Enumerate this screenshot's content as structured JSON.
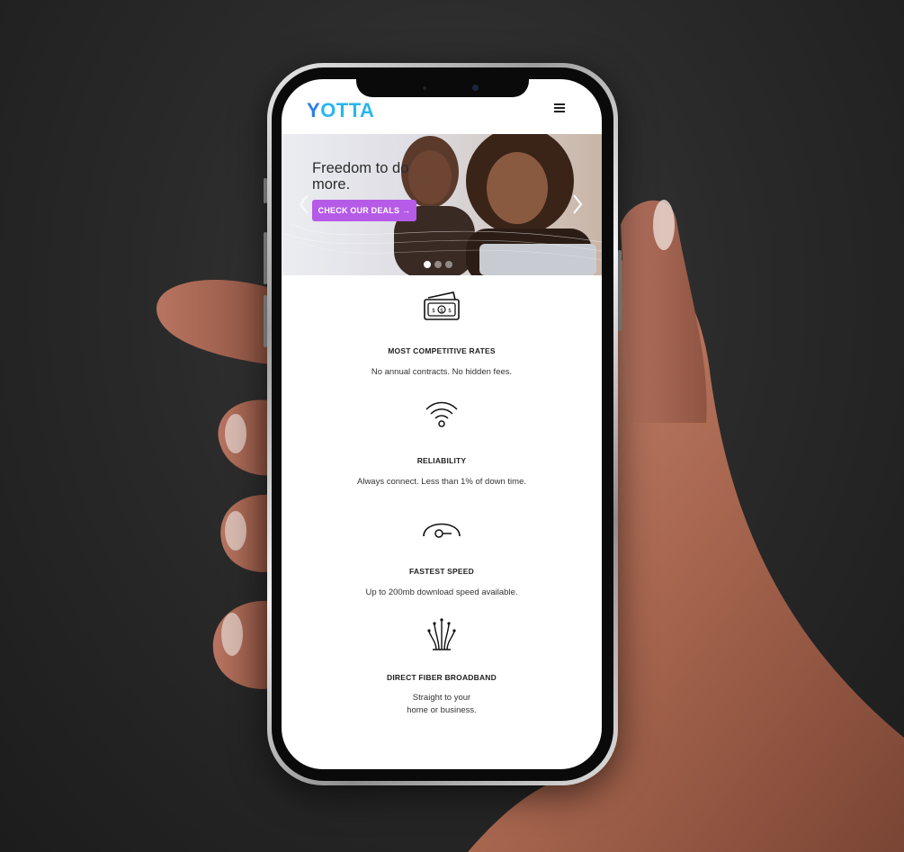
{
  "header": {
    "logo_first": "Y",
    "logo_rest": "OTTA"
  },
  "hero": {
    "title": "Freedom to do more.",
    "cta_label": "CHECK OUR DEALS",
    "cta_arrow": "→",
    "prev_icon": "chevron-left-icon",
    "next_icon": "chevron-right-icon",
    "slide_count": 3,
    "active_slide": 1
  },
  "features": [
    {
      "icon": "money-wallet-icon",
      "title": "MOST COMPETITIVE RATES",
      "description": "No annual contracts. No hidden fees."
    },
    {
      "icon": "wifi-icon",
      "title": "RELIABILITY",
      "description": "Always connect. Less than 1% of down time."
    },
    {
      "icon": "speedometer-icon",
      "title": "FASTEST SPEED",
      "description": "Up to 200mb download speed available."
    },
    {
      "icon": "fiber-optic-icon",
      "title": "DIRECT FIBER BROADBAND",
      "description_line1": "Straight to your",
      "description_line2": "home or business."
    }
  ],
  "colors": {
    "logo_blue": "#28b6ec",
    "logo_y": "#2a7ee8",
    "cta_purple": "#b55be8",
    "background": "#2a2a2a"
  }
}
